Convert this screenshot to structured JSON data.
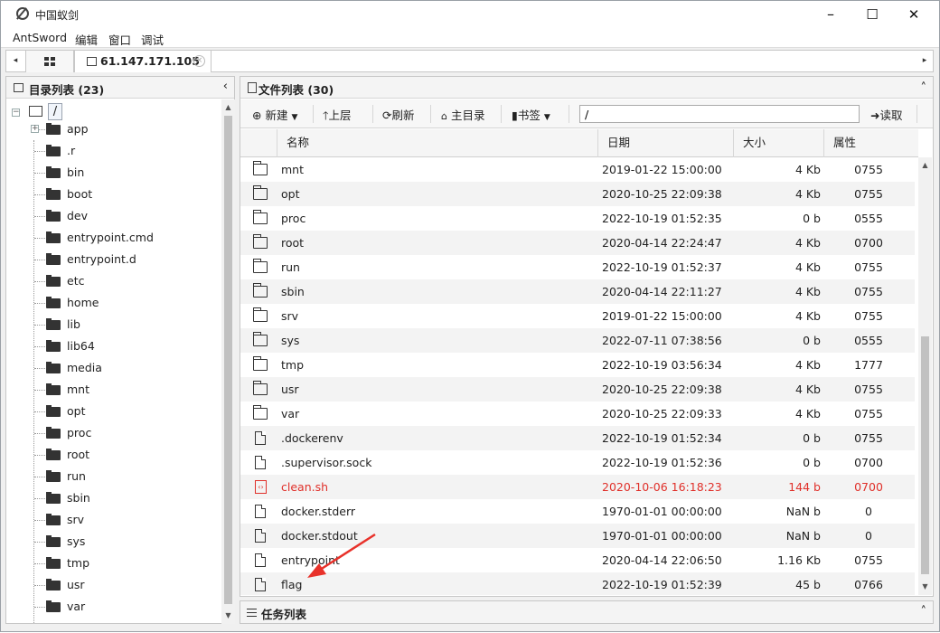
{
  "window": {
    "title": "中国蚁剑",
    "minimize": "–",
    "maximize": "☐",
    "close": "✕"
  },
  "menu": [
    "AntSword",
    "编辑",
    "窗口",
    "调试"
  ],
  "tabs": {
    "active_label": "61.147.171.105",
    "close": "×",
    "left": "◂",
    "right": "▸"
  },
  "left_panel": {
    "header": "目录列表 (23)",
    "collapse": "‹",
    "root": "/",
    "items": [
      "app",
      ".r",
      "bin",
      "boot",
      "dev",
      "entrypoint.cmd",
      "entrypoint.d",
      "etc",
      "home",
      "lib",
      "lib64",
      "media",
      "mnt",
      "opt",
      "proc",
      "root",
      "run",
      "sbin",
      "srv",
      "sys",
      "tmp",
      "usr",
      "var"
    ]
  },
  "right_panel": {
    "header": "文件列表 (30)",
    "collapse": "˄",
    "toolbar": {
      "new": "新建",
      "up": "上层",
      "refresh": "刷新",
      "home": "主目录",
      "bookmark": "书签",
      "path": "/",
      "read": "读取"
    },
    "columns": [
      "名称",
      "日期",
      "大小",
      "属性"
    ],
    "rows": [
      {
        "type": "folder",
        "name": "mnt",
        "date": "2019-01-22 15:00:00",
        "size": "4 Kb",
        "attr": "0755"
      },
      {
        "type": "folder",
        "name": "opt",
        "date": "2020-10-25 22:09:38",
        "size": "4 Kb",
        "attr": "0755"
      },
      {
        "type": "folder",
        "name": "proc",
        "date": "2022-10-19 01:52:35",
        "size": "0 b",
        "attr": "0555"
      },
      {
        "type": "folder",
        "name": "root",
        "date": "2020-04-14 22:24:47",
        "size": "4 Kb",
        "attr": "0700"
      },
      {
        "type": "folder",
        "name": "run",
        "date": "2022-10-19 01:52:37",
        "size": "4 Kb",
        "attr": "0755"
      },
      {
        "type": "folder",
        "name": "sbin",
        "date": "2020-04-14 22:11:27",
        "size": "4 Kb",
        "attr": "0755"
      },
      {
        "type": "folder",
        "name": "srv",
        "date": "2019-01-22 15:00:00",
        "size": "4 Kb",
        "attr": "0755"
      },
      {
        "type": "folder",
        "name": "sys",
        "date": "2022-07-11 07:38:56",
        "size": "0 b",
        "attr": "0555"
      },
      {
        "type": "folder",
        "name": "tmp",
        "date": "2022-10-19 03:56:34",
        "size": "4 Kb",
        "attr": "1777"
      },
      {
        "type": "folder",
        "name": "usr",
        "date": "2020-10-25 22:09:38",
        "size": "4 Kb",
        "attr": "0755"
      },
      {
        "type": "folder",
        "name": "var",
        "date": "2020-10-25 22:09:33",
        "size": "4 Kb",
        "attr": "0755"
      },
      {
        "type": "file",
        "name": ".dockerenv",
        "date": "2022-10-19 01:52:34",
        "size": "0 b",
        "attr": "0755"
      },
      {
        "type": "file",
        "name": ".supervisor.sock",
        "date": "2022-10-19 01:52:36",
        "size": "0 b",
        "attr": "0700"
      },
      {
        "type": "script",
        "name": "clean.sh",
        "date": "2020-10-06 16:18:23",
        "size": "144 b",
        "attr": "0700",
        "highlight": true
      },
      {
        "type": "file",
        "name": "docker.stderr",
        "date": "1970-01-01 00:00:00",
        "size": "NaN b",
        "attr": "0"
      },
      {
        "type": "file",
        "name": "docker.stdout",
        "date": "1970-01-01 00:00:00",
        "size": "NaN b",
        "attr": "0"
      },
      {
        "type": "file",
        "name": "entrypoint",
        "date": "2020-04-14 22:06:50",
        "size": "1.16 Kb",
        "attr": "0755"
      },
      {
        "type": "file",
        "name": "flag",
        "date": "2022-10-19 01:52:39",
        "size": "45 b",
        "attr": "0766"
      }
    ]
  },
  "bottom_panel": {
    "header": "任务列表",
    "expand": "˄"
  },
  "colors": {
    "highlight_red": "#e0302a",
    "annotation_arrow": "#e8312a"
  }
}
